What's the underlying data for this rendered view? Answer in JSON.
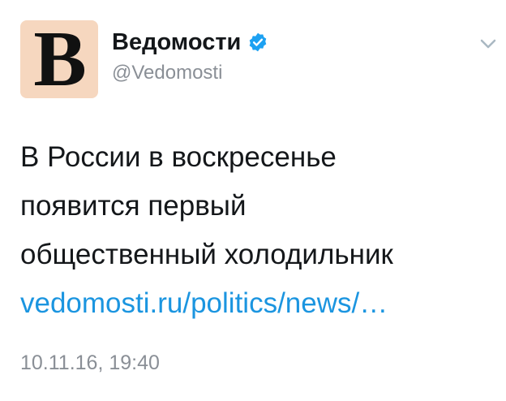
{
  "tweet": {
    "avatar_letter": "B",
    "display_name": "Ведомости",
    "handle": "@Vedomosti",
    "text_lines": [
      "В России в воскресенье",
      "появится первый",
      "общественный холодильник"
    ],
    "link_text": "vedomosti.ru/politics/news/…",
    "timestamp": "10.11.16, 19:40"
  },
  "icons": {
    "verified": "verified-badge-icon",
    "caret": "chevron-down-icon"
  },
  "colors": {
    "avatar_background": "#f6d7bf",
    "verified_blue": "#1da1f2",
    "link_blue": "#1b95e0",
    "secondary_text": "#8a8f96",
    "primary_text": "#14171a"
  }
}
